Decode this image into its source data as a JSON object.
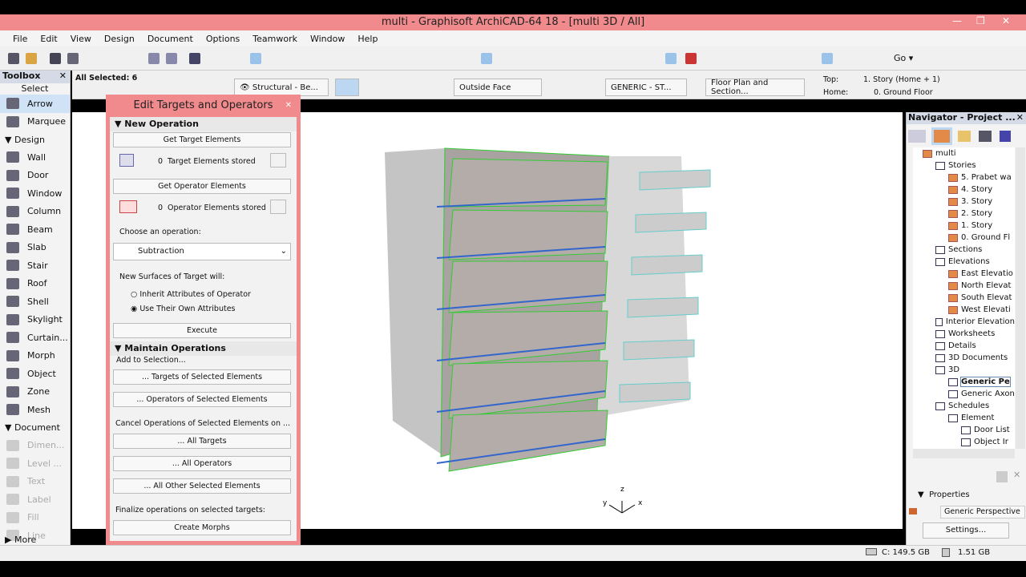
{
  "window": {
    "title": "multi - Graphisoft ArchiCAD-64 18 - [multi 3D / All]"
  },
  "menu": [
    "File",
    "Edit",
    "View",
    "Design",
    "Document",
    "Options",
    "Teamwork",
    "Window",
    "Help"
  ],
  "infobox": {
    "selection": "All Selected: 6",
    "layer": "Structural - Be...",
    "surface": "Outside Face",
    "composite": "GENERIC - ST...",
    "floor_plan": "Floor Plan and Section...",
    "top_label": "Top:",
    "top_value": "1. Story (Home + 1)",
    "home_label": "Home:",
    "home_value": "0. Ground Floor"
  },
  "toolbox": {
    "title": "Toolbox",
    "select": "Select",
    "arrow": "Arrow",
    "marquee": "Marquee",
    "design_label": "Design",
    "design_tools": [
      "Wall",
      "Door",
      "Window",
      "Column",
      "Beam",
      "Slab",
      "Stair",
      "Roof",
      "Shell",
      "Skylight",
      "Curtain...",
      "Morph",
      "Object",
      "Zone",
      "Mesh"
    ],
    "document_label": "Document",
    "document_tools": [
      "Dimen...",
      "Level ...",
      "Text",
      "Label",
      "Fill",
      "Line"
    ],
    "more": "More"
  },
  "dialog": {
    "title": "Edit Targets and Operators",
    "new_operation": "New Operation",
    "get_target": "Get Target Elements",
    "target_count": "0",
    "target_stored": "Target Elements stored",
    "get_operator": "Get Operator Elements",
    "operator_count": "0",
    "operator_stored": "Operator Elements stored",
    "choose_op": "Choose an operation:",
    "operation": "Subtraction",
    "new_surfaces": "New Surfaces of Target will:",
    "radio_inherit": "Inherit Attributes of Operator",
    "radio_own": "Use Their Own Attributes",
    "execute": "Execute",
    "maintain": "Maintain Operations",
    "add_sel": "Add to Selection...",
    "targets_sel": "... Targets of Selected Elements",
    "operators_sel": "... Operators of Selected Elements",
    "cancel_ops": "Cancel Operations of Selected Elements on ...",
    "all_targets": "... All Targets",
    "all_operators": "... All Operators",
    "all_other": "... All Other Selected Elements",
    "finalize": "Finalize operations on selected targets:",
    "create_morphs": "Create Morphs"
  },
  "axes": {
    "z": "z",
    "y": "y",
    "x": "x"
  },
  "navigator": {
    "title": "Navigator - Project ...",
    "items": [
      {
        "label": "multi",
        "level": 0,
        "icon": "project"
      },
      {
        "label": "Stories",
        "level": 1,
        "icon": "stories"
      },
      {
        "label": "5. Prabet wa",
        "level": 2,
        "icon": "story"
      },
      {
        "label": "4. Story",
        "level": 2,
        "icon": "story"
      },
      {
        "label": "3. Story",
        "level": 2,
        "icon": "story"
      },
      {
        "label": "2. Story",
        "level": 2,
        "icon": "story"
      },
      {
        "label": "1. Story",
        "level": 2,
        "icon": "story"
      },
      {
        "label": "0. Ground Fl",
        "level": 2,
        "icon": "story"
      },
      {
        "label": "Sections",
        "level": 1,
        "icon": "section"
      },
      {
        "label": "Elevations",
        "level": 1,
        "icon": "section"
      },
      {
        "label": "East Elevatio",
        "level": 2,
        "icon": "elevation"
      },
      {
        "label": "North Elevat",
        "level": 2,
        "icon": "elevation"
      },
      {
        "label": "South Elevat",
        "level": 2,
        "icon": "elevation"
      },
      {
        "label": "West Elevati",
        "level": 2,
        "icon": "elevation"
      },
      {
        "label": "Interior Elevation",
        "level": 1,
        "icon": "folder"
      },
      {
        "label": "Worksheets",
        "level": 1,
        "icon": "folder"
      },
      {
        "label": "Details",
        "level": 1,
        "icon": "folder"
      },
      {
        "label": "3D Documents",
        "level": 1,
        "icon": "folder"
      },
      {
        "label": "3D",
        "level": 1,
        "icon": "folder"
      },
      {
        "label": "Generic Pe",
        "level": 2,
        "icon": "camera",
        "selected": true
      },
      {
        "label": "Generic Axon",
        "level": 2,
        "icon": "axon"
      },
      {
        "label": "Schedules",
        "level": 1,
        "icon": "folder"
      },
      {
        "label": "Element",
        "level": 2,
        "icon": "folder"
      },
      {
        "label": "Door List",
        "level": 3,
        "icon": "list"
      },
      {
        "label": "Object Ir",
        "level": 3,
        "icon": "list"
      }
    ],
    "properties": "Properties",
    "view_name": "Generic Perspective",
    "settings": "Settings..."
  },
  "status": {
    "disk": "C: 149.5 GB",
    "ram": "1.51 GB"
  }
}
